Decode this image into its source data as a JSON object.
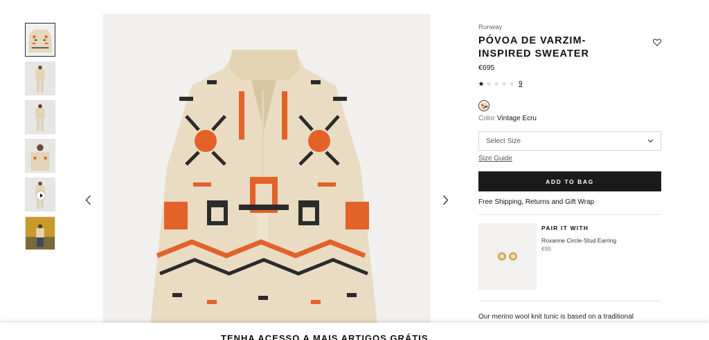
{
  "product": {
    "brand": "Runway",
    "title": "PÓVOA DE VARZIM-INSPIRED SWEATER",
    "price": "€695",
    "rating": 1,
    "rating_max": 5,
    "review_count": "9",
    "color_label": "Color",
    "color_value": "Vintage Ecru",
    "size_placeholder": "Select Size",
    "size_guide": "Size Guide",
    "add_to_bag": "ADD TO BAG",
    "shipping": "Free Shipping, Returns and Gift Wrap",
    "description": "Our merino wool knit tunic is based on a traditional"
  },
  "pair": {
    "heading": "PAIR IT WITH",
    "name": "Roxanne Circle-Stud Earring",
    "price": "€95"
  },
  "banner": {
    "text": "TENHA ACESSO A MAIS ARTIGOS GRÁTIS"
  },
  "colors": {
    "knit_base": "#e9dcc2",
    "orange": "#e2622a",
    "dark": "#2b2b2b",
    "button": "#1a1a1a"
  },
  "icons": {
    "wishlist": "heart-outline-icon",
    "prev": "chevron-left-icon",
    "next": "chevron-right-icon",
    "dropdown": "chevron-down-icon",
    "play": "play-icon"
  }
}
